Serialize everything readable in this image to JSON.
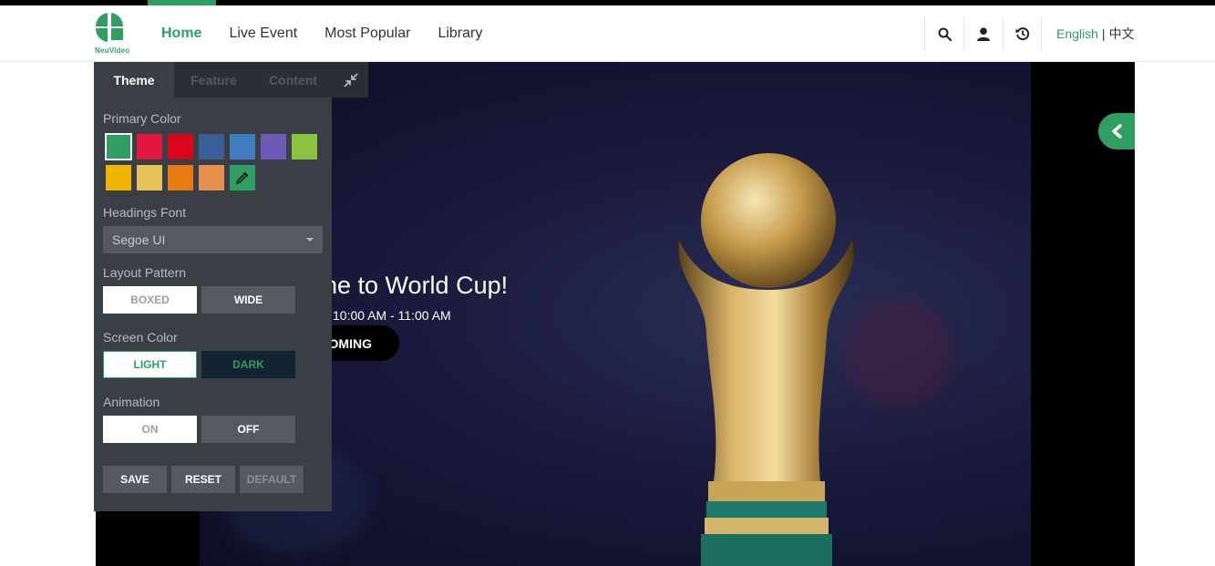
{
  "brand": {
    "logo_text": "NeuVideo",
    "accent": "#2f9e63"
  },
  "nav": [
    {
      "label": "Home",
      "active": true
    },
    {
      "label": "Live Event",
      "active": false
    },
    {
      "label": "Most Popular",
      "active": false
    },
    {
      "label": "Library",
      "active": false
    }
  ],
  "header_tools": [
    "search-icon",
    "user-icon",
    "history-icon"
  ],
  "language": {
    "current": "English",
    "separator": "|",
    "other": "中文"
  },
  "hero": {
    "title": "ne to World Cup!",
    "time": "10:00 AM - 11:00 AM",
    "button_label": "OMING"
  },
  "theme_panel": {
    "tabs": [
      {
        "label": "Theme",
        "active": true
      },
      {
        "label": "Feature",
        "active": false
      },
      {
        "label": "Content",
        "active": false
      }
    ],
    "primary_color": {
      "label": "Primary Color",
      "swatches": [
        "#2f9e63",
        "#e3173e",
        "#d8051b",
        "#3a5f96",
        "#3f7cc0",
        "#6e58b8",
        "#8cc43f",
        "#f0b500",
        "#e6c157",
        "#e57b12",
        "#e6904d"
      ],
      "selected": "#2f9e63",
      "picker_icon": "eyedropper-icon"
    },
    "headings_font": {
      "label": "Headings Font",
      "value": "Segoe UI"
    },
    "layout_pattern": {
      "label": "Layout Pattern",
      "options": [
        "BOXED",
        "WIDE"
      ]
    },
    "screen_color": {
      "label": "Screen Color",
      "options": [
        "LIGHT",
        "DARK"
      ]
    },
    "animation": {
      "label": "Animation",
      "options": [
        "ON",
        "OFF"
      ]
    },
    "actions": [
      "SAVE",
      "RESET",
      "DEFAULT"
    ]
  }
}
